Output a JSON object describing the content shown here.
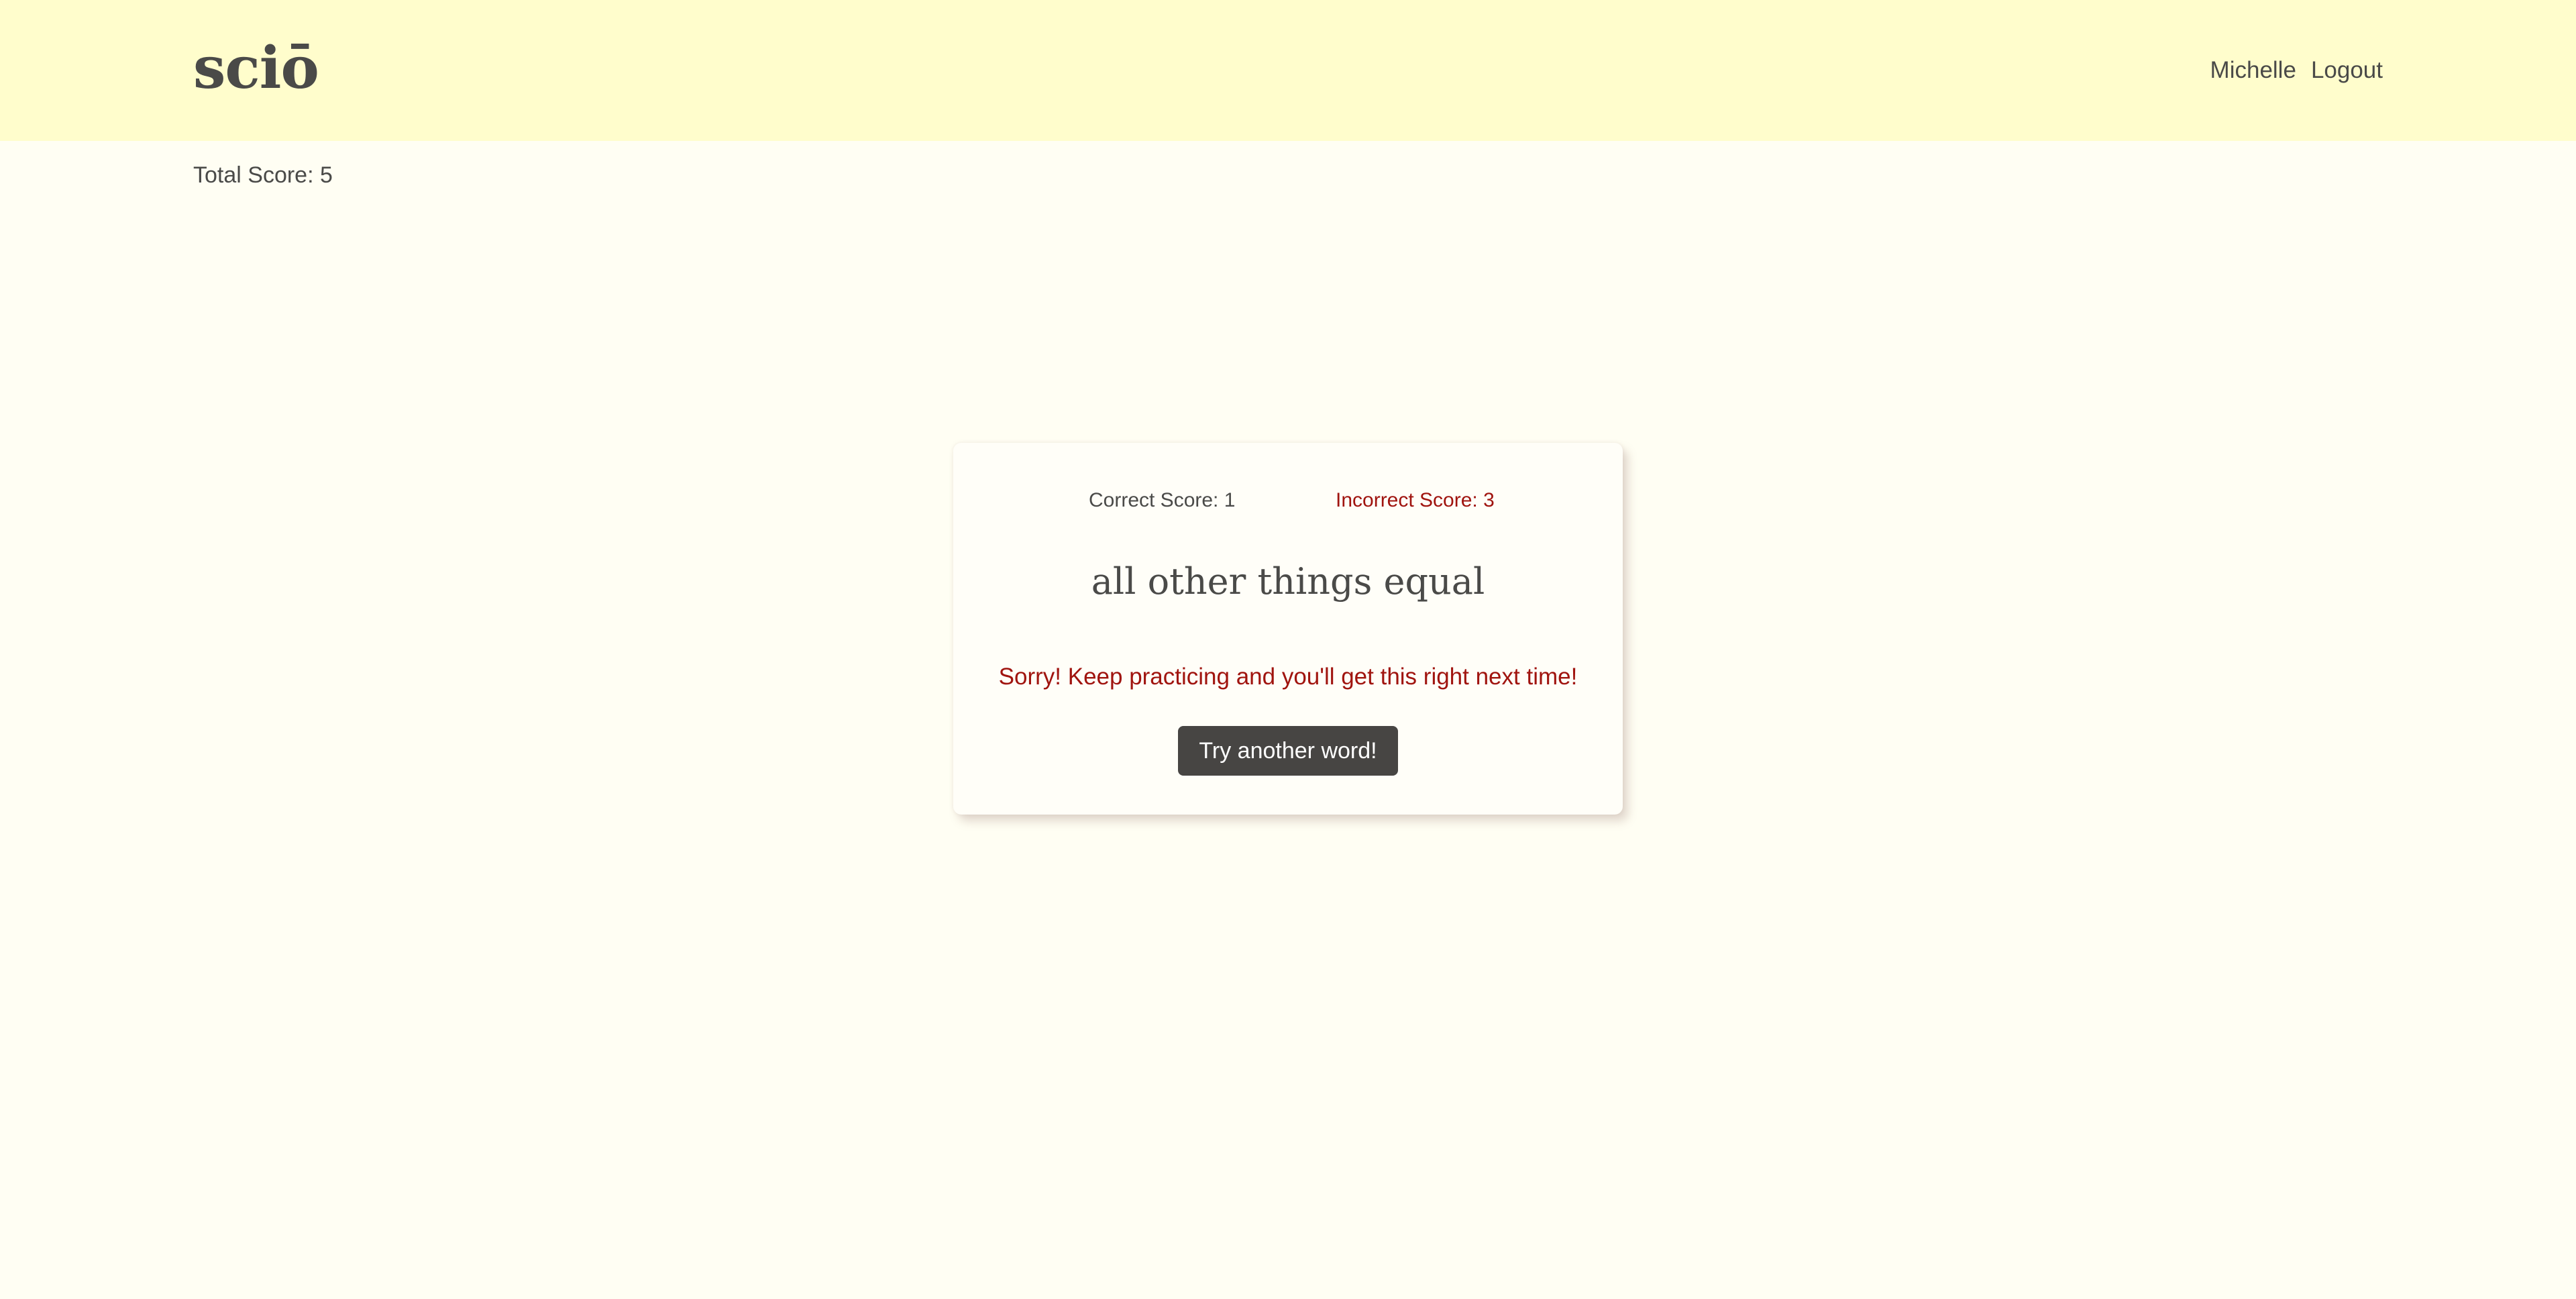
{
  "header": {
    "logo": "sciō",
    "nav": {
      "user_label": "Michelle",
      "logout_label": "Logout"
    }
  },
  "total_score_text": "Total Score: 5",
  "card": {
    "correct_score_text": "Correct Score: 1",
    "incorrect_score_text": "Incorrect Score: 3",
    "word": "all other things equal",
    "feedback": "Sorry! Keep practicing and you'll get this right next time!",
    "try_button_label": "Try another word!"
  },
  "colors": {
    "header_background": "#fffdcc",
    "page_background": "#fffef3",
    "text": "#4a4a48",
    "error_accent": "#a0140f",
    "button_background": "#474543"
  }
}
